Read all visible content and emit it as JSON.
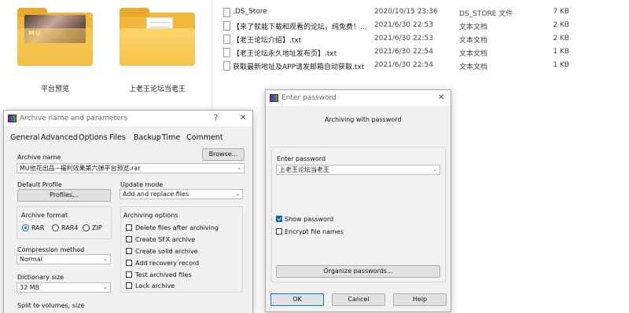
{
  "explorer": {
    "tiles": [
      {
        "label": "平台预览",
        "overlay": "MU"
      },
      {
        "label": "上老王论坛当老王"
      }
    ],
    "files": [
      {
        "name": ".DS_Store",
        "date": "2020/10/15 23:36",
        "type": "DS_STORE 文件",
        "size": "7 KB"
      },
      {
        "name": "【来了就能下载和观看的论坛，纯免费！...",
        "date": "2021/6/30 22:53",
        "type": "文本文档",
        "size": "2 KB"
      },
      {
        "name": "【老王论坛介绍】.txt",
        "date": "2021/6/30 22:53",
        "type": "文本文档",
        "size": "2 KB"
      },
      {
        "name": "【老王论坛永久地址发布页】.txt",
        "date": "2021/6/30 22:54",
        "type": "文本文档",
        "size": "1 KB"
      },
      {
        "name": "获取最新地址及APP请发邮箱自动获取.txt",
        "date": "2021/6/30 22:54",
        "type": "文本文档",
        "size": "1 KB"
      }
    ]
  },
  "archive_dialog": {
    "title": "Archive name and parameters",
    "help_btn": "?",
    "close_btn": "✕",
    "tabs": [
      "General",
      "Advanced",
      "Options",
      "Files",
      "Backup",
      "Time",
      "Comment"
    ],
    "archive_name_label": "Archive name",
    "browse_btn": "Browse...",
    "archive_name_value": "MU他花出品~福利效果第六弹平台预览.rar",
    "default_profile_label": "Default Profile",
    "profiles_btn": "Profiles...",
    "update_mode_label": "Update mode",
    "update_mode_value": "Add and replace files",
    "archive_format_label": "Archive format",
    "formats": [
      "RAR",
      "RAR4",
      "ZIP"
    ],
    "archiving_options_label": "Archiving options",
    "options": [
      "Delete files after archiving",
      "Create SFX archive",
      "Create solid archive",
      "Add recovery record",
      "Test archived files",
      "Lock archive"
    ],
    "compression_label": "Compression method",
    "compression_value": "Normal",
    "dictionary_label": "Dictionary size",
    "dictionary_value": "32 MB",
    "split_label": "Split to volumes, size"
  },
  "password_dialog": {
    "title": "Enter password",
    "close_btn": "✕",
    "heading": "Archiving with password",
    "enter_password_label": "Enter password",
    "password_value": "上老王论坛当老王",
    "show_password_label": "Show password",
    "show_password_checked": true,
    "encrypt_names_label": "Encrypt file names",
    "encrypt_names_checked": false,
    "organize_btn": "Organize passwords...",
    "ok_btn": "OK",
    "cancel_btn": "Cancel",
    "help_btn": "Help"
  }
}
